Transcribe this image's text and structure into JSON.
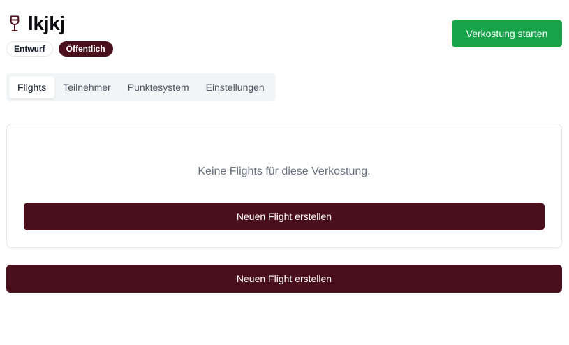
{
  "header": {
    "title": "lkjkj",
    "icon": "wine-glass-icon",
    "badges": {
      "draft": "Entwurf",
      "public": "Öffentlich"
    },
    "start_button_label": "Verkostung starten"
  },
  "tabs": [
    {
      "label": "Flights",
      "active": true
    },
    {
      "label": "Teilnehmer",
      "active": false
    },
    {
      "label": "Punktesystem",
      "active": false
    },
    {
      "label": "Einstellungen",
      "active": false
    }
  ],
  "flights_panel": {
    "empty_message": "Keine Flights für diese Verkostung.",
    "create_button_label": "Neuen Flight erstellen"
  },
  "footer": {
    "create_button_label": "Neuen Flight erstellen"
  },
  "colors": {
    "brand": "#4a0f1c",
    "start": "#16a34a",
    "muted_text": "#6b7280"
  }
}
